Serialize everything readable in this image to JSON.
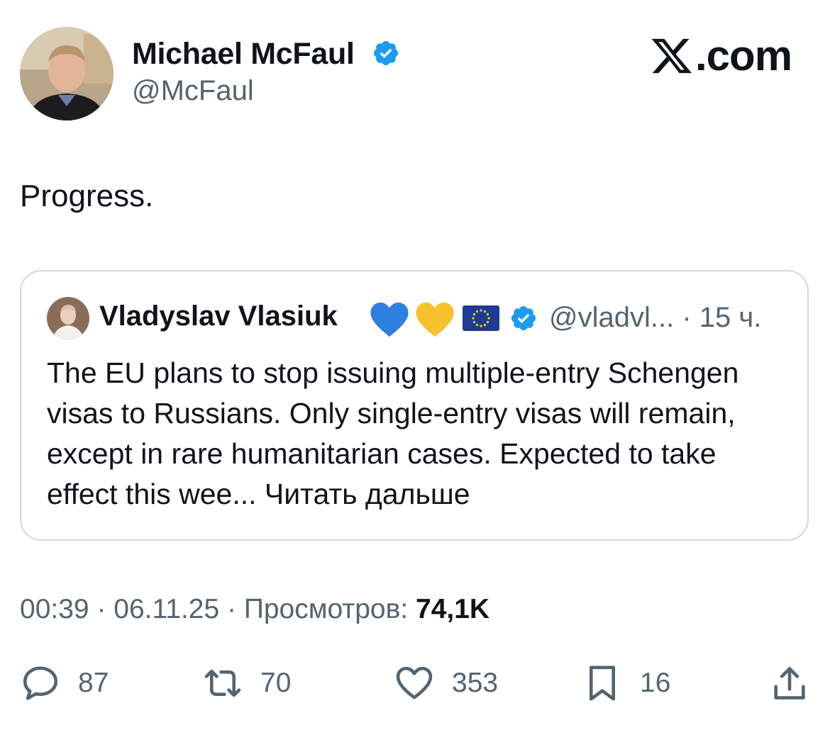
{
  "brand": {
    "label": ".com",
    "accent_color": "#1d9bf0"
  },
  "author": {
    "name": "Michael McFaul",
    "handle": "@McFaul",
    "verified": true
  },
  "tweet": {
    "text": "Progress."
  },
  "quoted": {
    "name": "Vladyslav Vlasiuk",
    "emojis": [
      "blue-heart",
      "yellow-heart",
      "eu-flag"
    ],
    "verified": true,
    "handle_time": "@vladvl... · 15 ч.",
    "text": "The EU plans to stop issuing multiple-entry Schengen visas to Russians. Only single-entry visas will remain, except in rare humanitarian cases. Expected to take effect this wee...",
    "read_more": "Читать дальше"
  },
  "meta": {
    "time_date": "00:39 · 06.11.25 · Просмотров:",
    "views": "74,1K"
  },
  "actions": {
    "replies": "87",
    "reposts": "70",
    "likes": "353",
    "bookmarks": "16"
  }
}
